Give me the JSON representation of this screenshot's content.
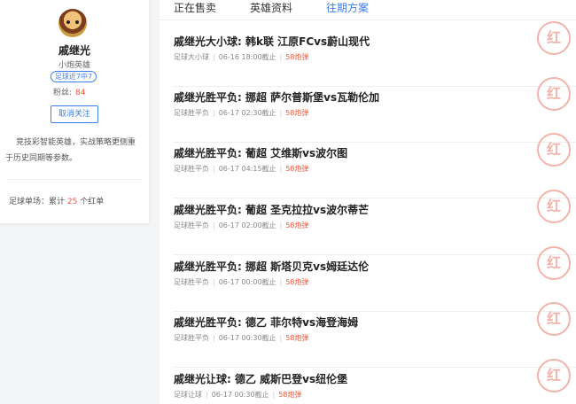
{
  "profile": {
    "name": "戚继光",
    "level": "小炮英雄",
    "badge": "足球近7中7",
    "fans_label": "粉丝:",
    "fans_count": "84",
    "unfollow": "取消关注",
    "description": "竞技彩智能英雄，实战策略更侧重于历史同期等参数。",
    "stat_prefix": "足球单场：累计",
    "stat_count": "25",
    "stat_suffix": "个红单"
  },
  "tabs": [
    {
      "label": "正在售卖",
      "active": false
    },
    {
      "label": "英雄资料",
      "active": false
    },
    {
      "label": "往期方案",
      "active": true
    }
  ],
  "stamp_text": "红",
  "items": [
    {
      "title": "戚继光大小球: 韩k联 江原FCvs蔚山现代",
      "type": "足球大小球",
      "time": "06-16 18:00截止",
      "count": "58炮弹"
    },
    {
      "title": "戚继光胜平负: 挪超 萨尔普斯堡vs瓦勒伦加",
      "type": "足球胜平负",
      "time": "06-17 02:30截止",
      "count": "58炮弹"
    },
    {
      "title": "戚继光胜平负: 葡超 艾维斯vs波尔图",
      "type": "足球胜平负",
      "time": "06-17 04:15截止",
      "count": "58炮弹"
    },
    {
      "title": "戚继光胜平负: 葡超 圣克拉拉vs波尔蒂芒",
      "type": "足球胜平负",
      "time": "06-17 02:00截止",
      "count": "58炮弹"
    },
    {
      "title": "戚继光胜平负: 挪超 斯塔贝克vs姆廷达伦",
      "type": "足球胜平负",
      "time": "06-17 00:00截止",
      "count": "58炮弹"
    },
    {
      "title": "戚继光胜平负: 德乙 菲尔特vs海登海姆",
      "type": "足球胜平负",
      "time": "06-17 00:30截止",
      "count": "58炮弹"
    },
    {
      "title": "戚继光让球: 德乙 威斯巴登vs纽伦堡",
      "type": "足球让球",
      "time": "06-17 00:30截止",
      "count": "58炮弹"
    }
  ]
}
